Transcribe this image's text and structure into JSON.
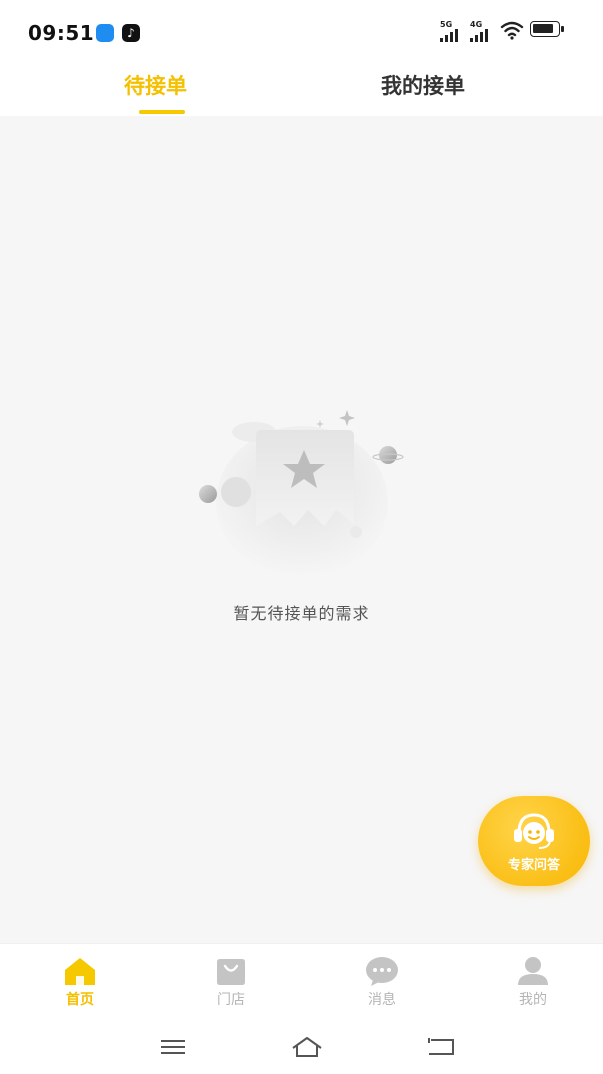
{
  "status_bar": {
    "time": "09:51",
    "signal1_label": "5G",
    "signal2_label": "4G",
    "icons": [
      "blue-app-icon",
      "tiktok-icon",
      "wifi-icon",
      "battery-icon"
    ]
  },
  "tabs": [
    {
      "label": "待接单",
      "active": true
    },
    {
      "label": "我的接单",
      "active": false
    }
  ],
  "empty_state": {
    "message": "暂无待接单的需求",
    "icon": "empty-star-document-icon"
  },
  "fab": {
    "label": "专家问答",
    "icon": "customer-service-headset-icon"
  },
  "bottom_nav": [
    {
      "label": "首页",
      "icon": "home-icon",
      "active": true
    },
    {
      "label": "门店",
      "icon": "store-bag-icon",
      "active": false
    },
    {
      "label": "消息",
      "icon": "message-bubble-icon",
      "active": false
    },
    {
      "label": "我的",
      "icon": "person-icon",
      "active": false
    }
  ],
  "system_nav": {
    "icons": [
      "menu-icon",
      "home-outline-icon",
      "back-icon"
    ]
  },
  "colors": {
    "accent": "#f5c800",
    "content_bg": "#f6f6f6",
    "inactive": "#b5b5b5"
  }
}
